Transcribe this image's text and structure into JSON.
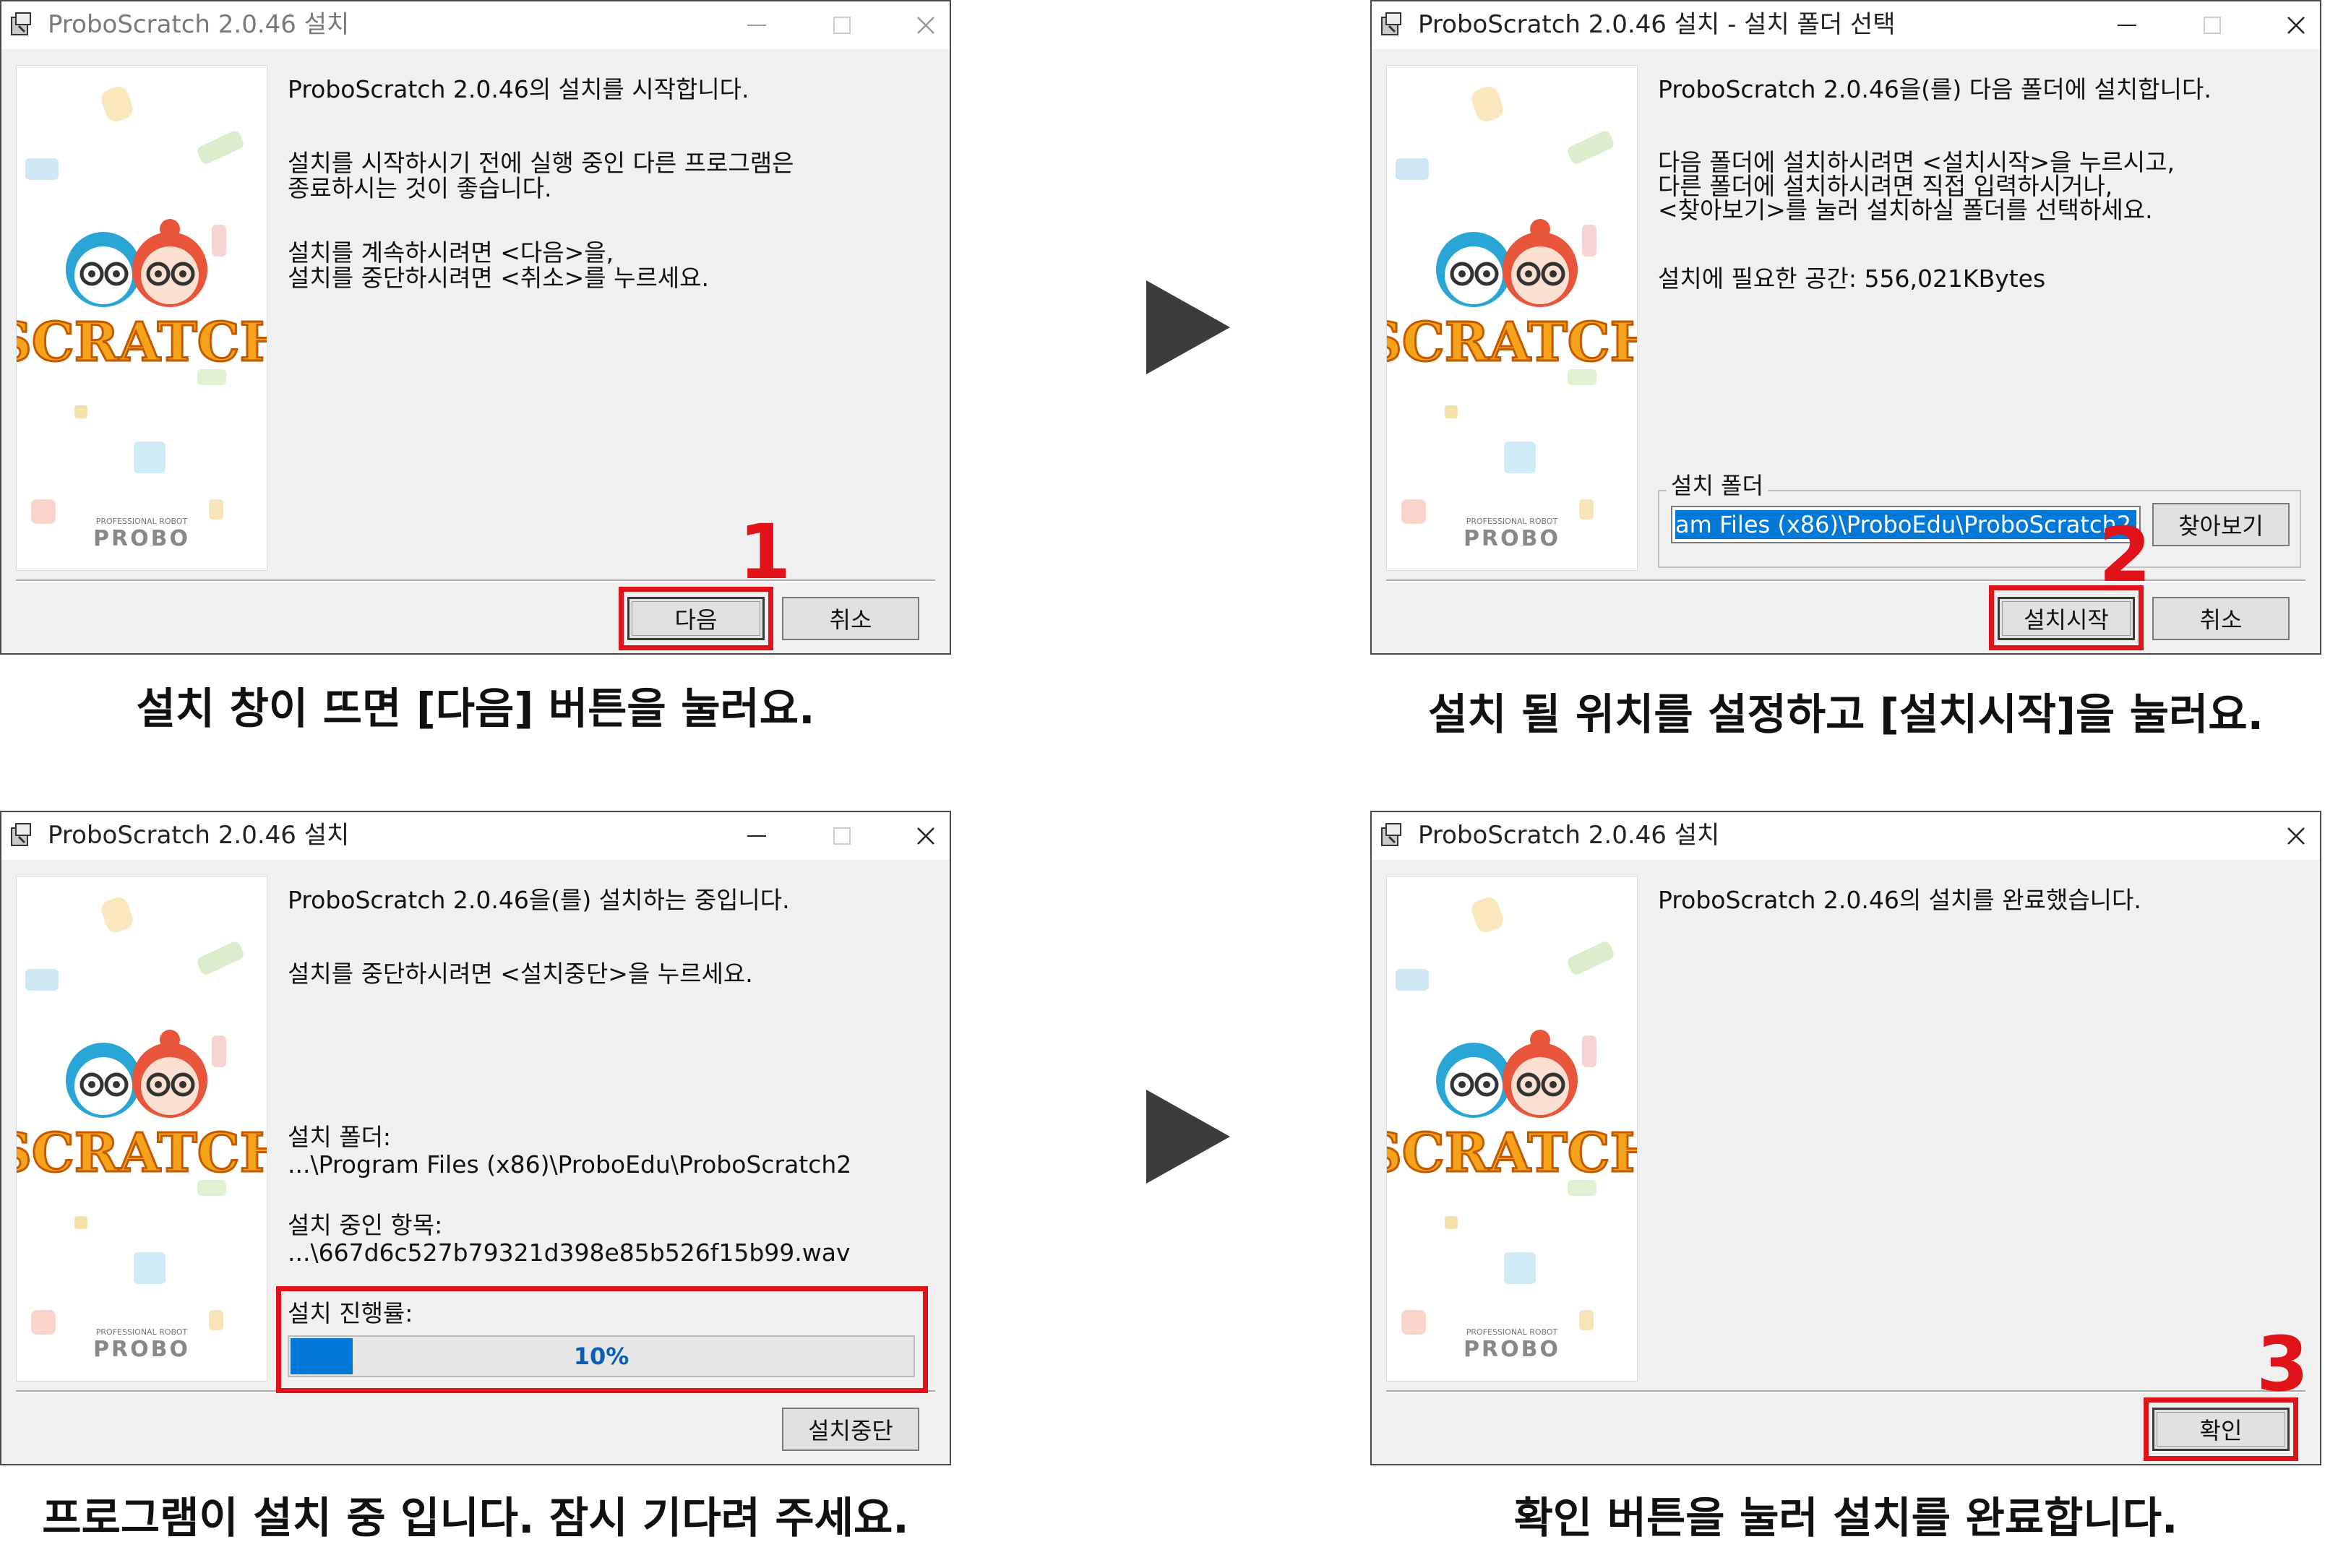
{
  "app": {
    "title_base": "ProboScratch 2.0.46 설치",
    "title_folder": "ProboScratch 2.0.46 설치 - 설치 폴더 선택"
  },
  "side_image": {
    "logo_text": "SCRATCH",
    "brand_small": "PROFESSIONAL ROBOT",
    "brand": "PROBO"
  },
  "step1": {
    "line1": "ProboScratch 2.0.46의 설치를 시작합니다.",
    "line2": "설치를 시작하시기 전에 실행 중인 다른 프로그램은\n종료하시는 것이 좋습니다.",
    "line3": "설치를 계속하시려면 <다음>을,\n설치를 중단하시려면 <취소>를 누르세요.",
    "next_label": "다음",
    "cancel_label": "취소",
    "marker": "1",
    "caption": "설치 창이 뜨면 [다음] 버튼을 눌러요."
  },
  "step2": {
    "line1": "ProboScratch 2.0.46을(를) 다음 폴더에 설치합니다.",
    "line2": "다음 폴더에 설치하시려면 <설치시작>을 누르시고,\n다른 폴더에 설치하시려면 직접 입력하시거나,\n<찾아보기>를 눌러 설치하실 폴더를 선택하세요.",
    "space": "설치에 필요한 공간: 556,021KBytes",
    "folder_label": "설치 폴더",
    "folder_value": "am Files (x86)\\ProboEdu\\ProboScratch2",
    "browse_label": "찾아보기",
    "install_label": "설치시작",
    "cancel_label": "취소",
    "marker": "2",
    "caption": "설치 될 위치를 설정하고 [설치시작]을 눌러요."
  },
  "step3": {
    "line1": "ProboScratch 2.0.46을(를) 설치하는 중입니다.",
    "line2": "설치를 중단하시려면 <설치중단>을 누르세요.",
    "folder_label": "설치 폴더:",
    "folder_value": "...\\Program Files (x86)\\ProboEdu\\ProboScratch2",
    "item_label": "설치 중인 항목:",
    "item_value": "...\\667d6c527b79321d398e85b526f15b99.wav",
    "progress_label": "설치 진행률:",
    "progress_value": 0.1,
    "progress_text": "10%",
    "stop_label": "설치중단",
    "caption": "프로그램이 설치 중 입니다. 잠시 기다려 주세요."
  },
  "step4": {
    "line1": "ProboScratch 2.0.46의 설치를 완료했습니다.",
    "ok_label": "확인",
    "marker": "3",
    "caption": "확인 버튼을 눌러 설치를 완료합니다."
  },
  "colors": {
    "highlight": "#e0131a",
    "progress": "#0078d7",
    "dialog_bg": "#f0f0f0"
  },
  "icons": [
    "installer-icon",
    "minimize-icon",
    "maximize-icon",
    "close-icon",
    "next-step-arrow-icon"
  ]
}
